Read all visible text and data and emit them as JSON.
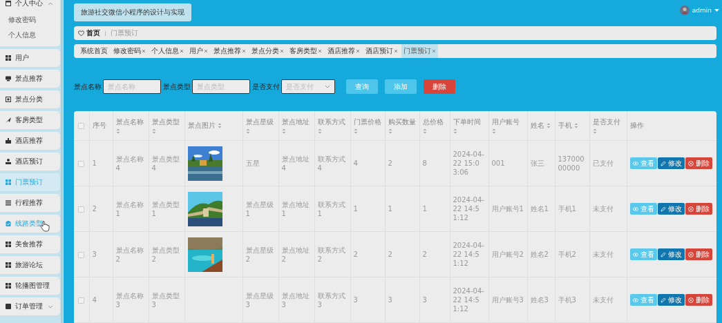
{
  "app": {
    "title": "旅游社交微信小程序的设计与实现"
  },
  "user": {
    "name": "admin"
  },
  "sidebar": {
    "items": [
      {
        "label": "个人中心",
        "selected": false,
        "hovered": false,
        "expanded": true,
        "children": [
          {
            "label": "修改密码",
            "selected": false,
            "hovered": false
          },
          {
            "label": "个人信息",
            "selected": false,
            "hovered": false
          }
        ]
      },
      {
        "label": "用户",
        "selected": false,
        "hovered": false
      },
      {
        "label": "景点推荐",
        "selected": false,
        "hovered": false
      },
      {
        "label": "景点分类",
        "selected": false,
        "hovered": false
      },
      {
        "label": "客房类型",
        "selected": false,
        "hovered": false
      },
      {
        "label": "酒店推荐",
        "selected": false,
        "hovered": false
      },
      {
        "label": "酒店预订",
        "selected": false,
        "hovered": false
      },
      {
        "label": "门票预订",
        "selected": true,
        "hovered": false
      },
      {
        "label": "行程推荐",
        "selected": false,
        "hovered": false
      },
      {
        "label": "线路类型",
        "selected": false,
        "hovered": true
      },
      {
        "label": "美食推荐",
        "selected": false,
        "hovered": false
      },
      {
        "label": "旅游论坛",
        "selected": false,
        "hovered": false
      },
      {
        "label": "轮播图管理",
        "selected": false,
        "hovered": false
      },
      {
        "label": "订单管理",
        "selected": false,
        "hovered": false,
        "expanded": false
      }
    ]
  },
  "breadcrumb": {
    "home": "首页",
    "current": "门票预订"
  },
  "tabs": [
    {
      "label": "系统首页",
      "closable": false,
      "selected": false
    },
    {
      "label": "修改密码",
      "closable": true,
      "selected": false
    },
    {
      "label": "个人信息",
      "closable": true,
      "selected": false
    },
    {
      "label": "用户",
      "closable": true,
      "selected": false
    },
    {
      "label": "景点推荐",
      "closable": true,
      "selected": false
    },
    {
      "label": "景点分类",
      "closable": true,
      "selected": false
    },
    {
      "label": "客房类型",
      "closable": true,
      "selected": false
    },
    {
      "label": "酒店推荐",
      "closable": true,
      "selected": false
    },
    {
      "label": "酒店预订",
      "closable": true,
      "selected": false
    },
    {
      "label": "门票预订",
      "closable": true,
      "selected": true
    }
  ],
  "filters": [
    {
      "kind": "text",
      "label": "景点名称",
      "placeholder": "景点名称"
    },
    {
      "kind": "text",
      "label": "景点类型",
      "placeholder": "景点类型"
    },
    {
      "kind": "select",
      "label": "是否支付",
      "placeholder": "是否支付"
    }
  ],
  "buttons": [
    {
      "label": "查询",
      "kind": "primary"
    },
    {
      "label": "添加",
      "kind": "primary"
    },
    {
      "label": "删除",
      "kind": "danger"
    }
  ],
  "table": {
    "select_all": {
      "checked": false
    },
    "columns": [
      {
        "label": "序号",
        "sortable": false
      },
      {
        "label": "景点名称",
        "sortable": true
      },
      {
        "label": "景点类型",
        "sortable": true
      },
      {
        "label": "景点图片",
        "sortable": true
      },
      {
        "label": "景点星级",
        "sortable": true
      },
      {
        "label": "景点地址",
        "sortable": true
      },
      {
        "label": "联系方式",
        "sortable": true
      },
      {
        "label": "门票价格",
        "sortable": true
      },
      {
        "label": "购买数量",
        "sortable": true
      },
      {
        "label": "总价格",
        "sortable": true
      },
      {
        "label": "下单时间",
        "sortable": true
      },
      {
        "label": "用户账号",
        "sortable": true
      },
      {
        "label": "姓名",
        "sortable": true
      },
      {
        "label": "手机",
        "sortable": true
      },
      {
        "label": "是否支付",
        "sortable": true
      },
      {
        "label": "操作",
        "sortable": false
      }
    ],
    "rows": [
      {
        "checked": false,
        "cells": [
          "1",
          "景点名称4",
          "景点类型4",
          null,
          "五星",
          "景点地址4",
          "联系方式4",
          "4",
          "2",
          "8",
          "2024-04-22 15:03:06",
          "001",
          "张三",
          "13700000000",
          "已支付"
        ],
        "image": {
          "kind": "picture"
        },
        "actions": [
          "查看",
          "修改",
          "删除"
        ]
      },
      {
        "checked": false,
        "cells": [
          "2",
          "景点名称1",
          "景点类型1",
          null,
          "景点星级1",
          "景点地址1",
          "联系方式1",
          "1",
          "1",
          "1",
          "2024-04-22 14:51:12",
          "用户账号1",
          "姓名1",
          "手机1",
          "未支付"
        ],
        "image": {
          "kind": "picture"
        },
        "actions": [
          "查看",
          "修改",
          "删除"
        ]
      },
      {
        "checked": false,
        "cells": [
          "3",
          "景点名称2",
          "景点类型2",
          null,
          "景点星级2",
          "景点地址2",
          "联系方式2",
          "2",
          "2",
          "2",
          "2024-04-22 14:51:12",
          "用户账号2",
          "姓名2",
          "手机2",
          "未支付"
        ],
        "image": {
          "kind": "picture"
        },
        "actions": [
          "查看",
          "修改",
          "删除"
        ]
      },
      {
        "checked": false,
        "cells": [
          "4",
          "景点名称3",
          "景点类型3",
          null,
          "景点星级3",
          "景点地址3",
          "联系方式3",
          "3",
          "3",
          "3",
          "2024-04-22 14:51:12",
          "用户账号3",
          "姓名3",
          "手机3",
          "未支付"
        ],
        "actions": [
          "查看",
          "修改",
          "删除"
        ]
      }
    ]
  }
}
